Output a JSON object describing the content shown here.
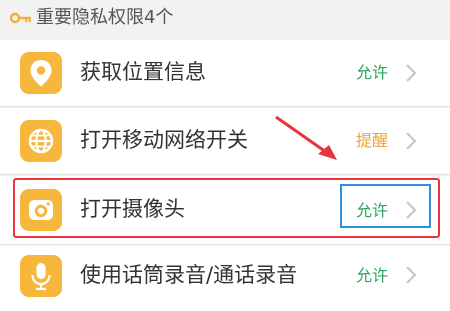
{
  "header": {
    "title": "重要隐私权限4个",
    "icon": "key-icon"
  },
  "colors": {
    "page_background": "#f2f2f2",
    "icon_background": "#f6b73c",
    "allow": "#2aa45c",
    "remind": "#e9a43a",
    "highlight_red": "#e8323c",
    "highlight_blue": "#2f8fd8"
  },
  "permissions": [
    {
      "icon": "location-pin-icon",
      "label": "获取位置信息",
      "status": "允许"
    },
    {
      "icon": "globe-icon",
      "label": "打开移动网络开关",
      "status": "提醒"
    },
    {
      "icon": "camera-icon",
      "label": "打开摄像头",
      "status": "允许"
    },
    {
      "icon": "microphone-icon",
      "label": "使用话筒录音/通话录音",
      "status": "允许"
    }
  ]
}
